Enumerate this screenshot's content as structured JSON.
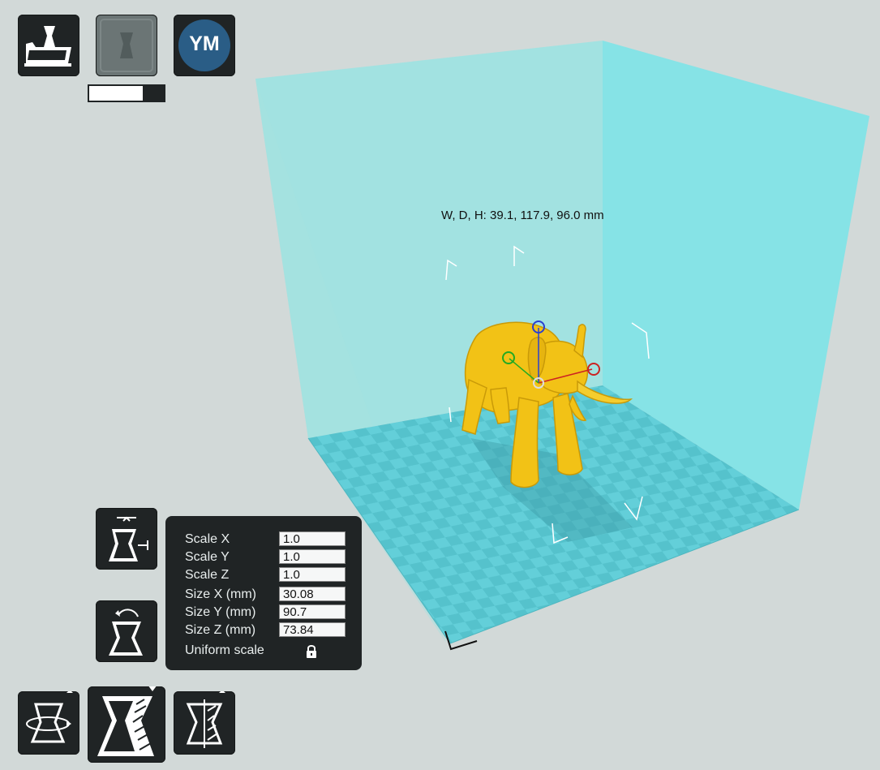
{
  "toolbar": {
    "load_icon": "folder-load-icon",
    "print_icon": "print-icon",
    "ym_label": "YM",
    "progress_fraction": 0.72
  },
  "viewport": {
    "dimensions_label": "W, D, H: 39.1, 117.9, 96.0 mm",
    "volume_color": "#7fe0e4",
    "bed_color": "#63cfd9",
    "model_color": "#f2c216"
  },
  "scale_panel": {
    "rows": [
      {
        "label": "Scale X",
        "value": "1.0"
      },
      {
        "label": "Scale Y",
        "value": "1.0"
      },
      {
        "label": "Scale Z",
        "value": "1.0"
      },
      {
        "label": "Size X (mm)",
        "value": "30.08"
      },
      {
        "label": "Size Y (mm)",
        "value": "90.7"
      },
      {
        "label": "Size Z (mm)",
        "value": "73.84"
      }
    ],
    "uniform_label": "Uniform scale",
    "lock_icon": "lock-icon"
  },
  "tools": {
    "lay_flat_icon": "lay-flat-icon",
    "reset_scale_icon": "reset-scale-icon",
    "rotate_icon": "rotate-icon",
    "scale_icon": "scale-icon",
    "mirror_icon": "mirror-icon"
  }
}
